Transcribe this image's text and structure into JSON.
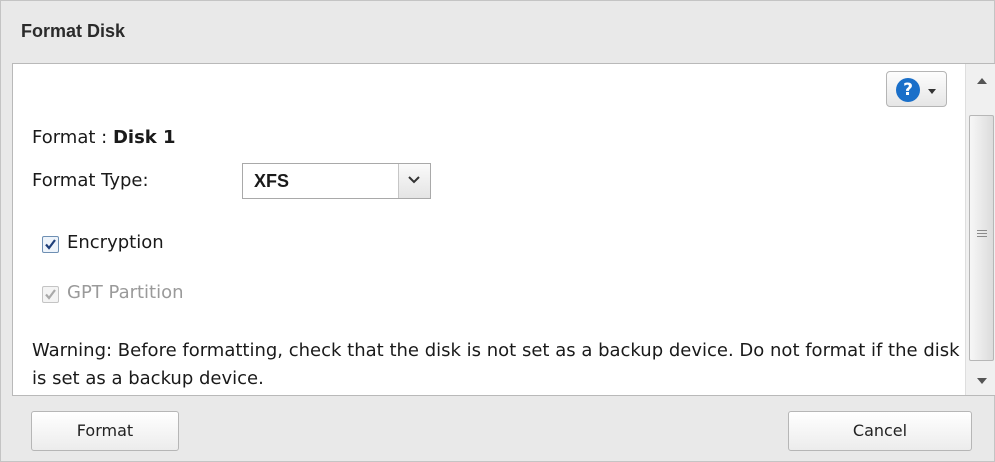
{
  "dialog": {
    "title": "Format Disk",
    "help_symbol": "?",
    "format_label": "Format :",
    "format_value": "Disk 1",
    "format_type_label": "Format Type:",
    "format_type_selected": "XFS",
    "encryption_label": "Encryption",
    "encryption_checked": true,
    "gpt_label": "GPT Partition",
    "gpt_checked": true,
    "gpt_disabled": true,
    "warning_text": "Warning: Before formatting, check that the disk is not set as a backup device. Do not format if the disk is set as a backup device."
  },
  "footer": {
    "format_button": "Format",
    "cancel_button": "Cancel"
  },
  "colors": {
    "help_blue": "#1a6fc9",
    "background": "#e9e9e9"
  },
  "icons": {
    "help": "help-question-icon",
    "dropdown": "chevron-down-icon",
    "checkmark": "check-icon"
  }
}
